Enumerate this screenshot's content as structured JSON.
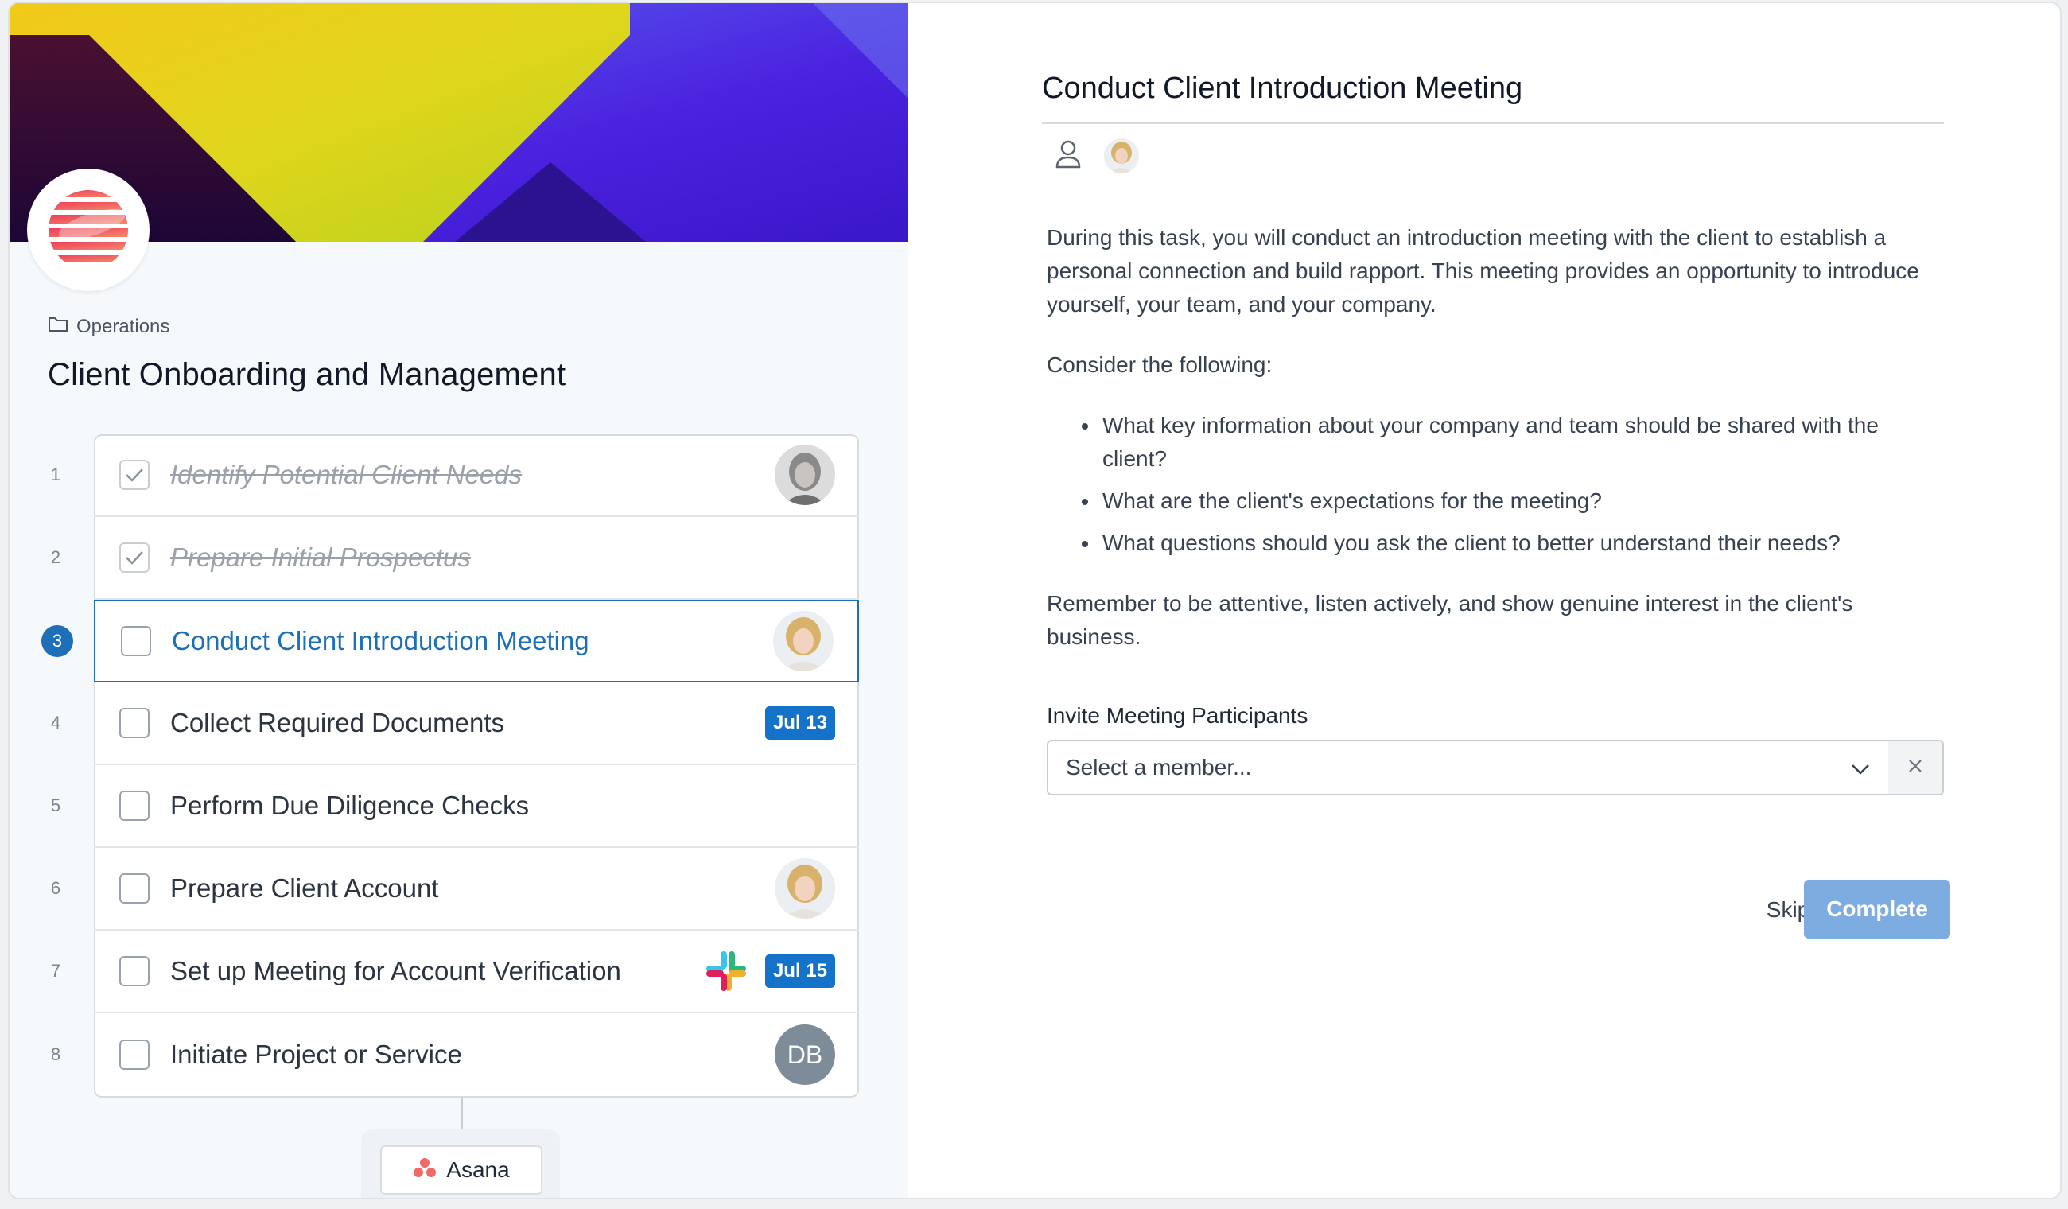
{
  "breadcrumb": {
    "icon": "folder-icon",
    "label": "Operations"
  },
  "workflow_title": "Client Onboarding and Management",
  "steps": [
    {
      "number": "1",
      "label": "Identify Potential Client Needs",
      "status": "done",
      "assignee": "avatar-woman-dark"
    },
    {
      "number": "2",
      "label": "Prepare Initial Prospectus",
      "status": "done"
    },
    {
      "number": "3",
      "label": "Conduct Client Introduction Meeting",
      "status": "active",
      "assignee": "avatar-woman-blonde"
    },
    {
      "number": "4",
      "label": "Collect Required Documents",
      "status": "todo",
      "due": "Jul 13"
    },
    {
      "number": "5",
      "label": "Perform Due Diligence Checks",
      "status": "todo"
    },
    {
      "number": "6",
      "label": "Prepare Client Account",
      "status": "todo",
      "assignee": "avatar-woman-blonde"
    },
    {
      "number": "7",
      "label": "Set up Meeting for Account Verification",
      "status": "todo",
      "integration": "slack-icon",
      "due": "Jul 15"
    },
    {
      "number": "8",
      "label": "Initiate Project or Service",
      "status": "todo",
      "assignee_initials": "DB"
    }
  ],
  "integration_badge": {
    "icon": "asana-icon",
    "label": "Asana"
  },
  "task": {
    "title": "Conduct Client Introduction Meeting",
    "description_1": "During this task, you will conduct an introduction meeting with the client to establish a personal connection and build rapport. This meeting provides an opportunity to introduce yourself, your team, and your company.",
    "description_2": "Consider the following:",
    "bullets": [
      "What key information about your company and team should be shared with the client?",
      "What are the client's expectations for the meeting?",
      "What questions should you ask the client to better understand their needs?"
    ],
    "description_3": "Remember to be attentive, listen actively, and show genuine interest in the client's business.",
    "invite_label": "Invite Meeting Participants",
    "select_placeholder": "Select a member...",
    "skip_label": "Skip",
    "complete_label": "Complete"
  },
  "colors": {
    "accent": "#1d6fb8",
    "badge": "#1473c9",
    "complete_disabled": "#7dace0"
  }
}
